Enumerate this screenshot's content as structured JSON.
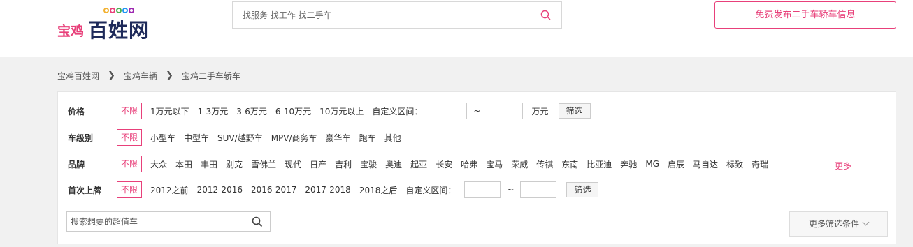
{
  "header": {
    "logo": {
      "city": "宝鸡",
      "brand": "百姓网",
      "dot_colors": [
        "#f2b130",
        "#e8407a",
        "#4caf50",
        "#2196f3",
        "#9c27b0"
      ]
    },
    "search_placeholder": "找服务 找工作 找二手车",
    "publish_label": "免费发布二手车轿车信息"
  },
  "breadcrumb": [
    "宝鸡百姓网",
    "宝鸡车辆",
    "宝鸡二手车轿车"
  ],
  "filters": {
    "no_limit": "不限",
    "price": {
      "label": "价格",
      "options": [
        "1万元以下",
        "1-3万元",
        "3-6万元",
        "6-10万元",
        "10万元以上"
      ],
      "custom_label": "自定义区间：",
      "unit": "万元",
      "button": "筛选"
    },
    "level": {
      "label": "车级别",
      "options": [
        "小型车",
        "中型车",
        "SUV/越野车",
        "MPV/商务车",
        "豪华车",
        "跑车",
        "其他"
      ]
    },
    "brand": {
      "label": "品牌",
      "options": [
        "大众",
        "本田",
        "丰田",
        "别克",
        "雪佛兰",
        "现代",
        "日产",
        "吉利",
        "宝骏",
        "奥迪",
        "起亚",
        "长安",
        "哈弗",
        "宝马",
        "荣威",
        "传祺",
        "东南",
        "比亚迪",
        "奔驰",
        "MG",
        "启辰",
        "马自达",
        "标致",
        "奇瑞"
      ],
      "more": "更多"
    },
    "first_reg": {
      "label": "首次上牌",
      "options": [
        "2012之前",
        "2012-2016",
        "2016-2017",
        "2017-2018",
        "2018之后"
      ],
      "custom_label": "自定义区间：",
      "button": "筛选"
    },
    "search_placeholder": "搜索想要的超值车",
    "more_filters": "更多筛选条件"
  },
  "colors": {
    "accent": "#e8407a",
    "brand_dark": "#1e2a5a"
  }
}
